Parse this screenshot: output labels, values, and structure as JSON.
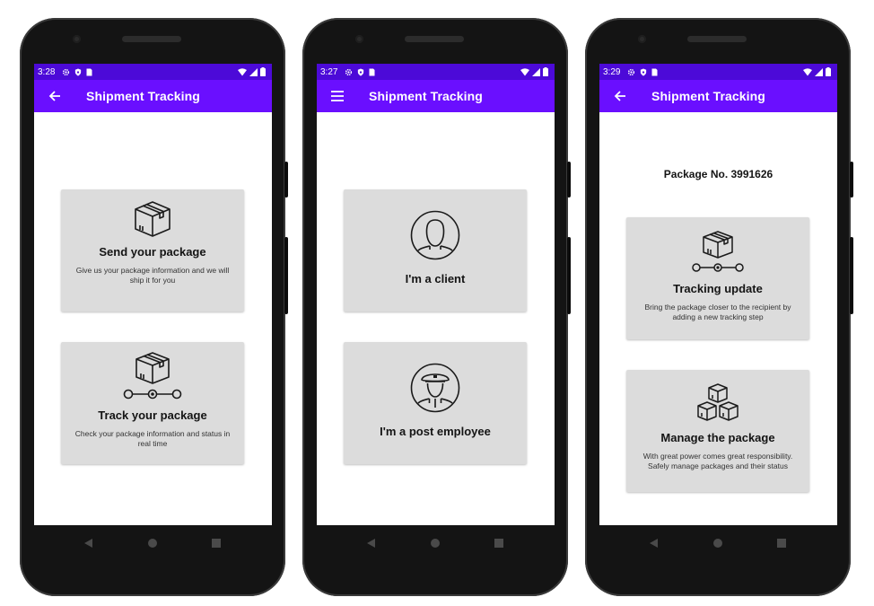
{
  "colors": {
    "appbar": "#6a0fff",
    "statusbar": "#4c0ad8",
    "card": "#dcdcdc",
    "phone": "#141414"
  },
  "phones": [
    {
      "status_time": "3:28",
      "app_title": "Shipment Tracking",
      "nav_icon": "back-arrow-icon",
      "cards": [
        {
          "icon": "package-icon",
          "title": "Send your package",
          "description": "Give us your package information and we will ship it for you"
        },
        {
          "icon": "package-tracking-icon",
          "title": "Track your package",
          "description": "Check your package information and status in real time"
        }
      ]
    },
    {
      "status_time": "3:27",
      "app_title": "Shipment Tracking",
      "nav_icon": "menu-icon",
      "cards": [
        {
          "icon": "client-avatar-icon",
          "title": "I'm a client"
        },
        {
          "icon": "post-employee-avatar-icon",
          "title": "I'm a post employee"
        }
      ]
    },
    {
      "status_time": "3:29",
      "app_title": "Shipment Tracking",
      "nav_icon": "back-arrow-icon",
      "package_number": "Package No. 3991626",
      "cards": [
        {
          "icon": "package-tracking-icon",
          "title": "Tracking update",
          "description": "Bring the package closer to the recipient by adding a new tracking step"
        },
        {
          "icon": "packages-stack-icon",
          "title": "Manage the package",
          "description": "With great power comes great responsibility. Safely manage packages and their status"
        }
      ]
    }
  ]
}
